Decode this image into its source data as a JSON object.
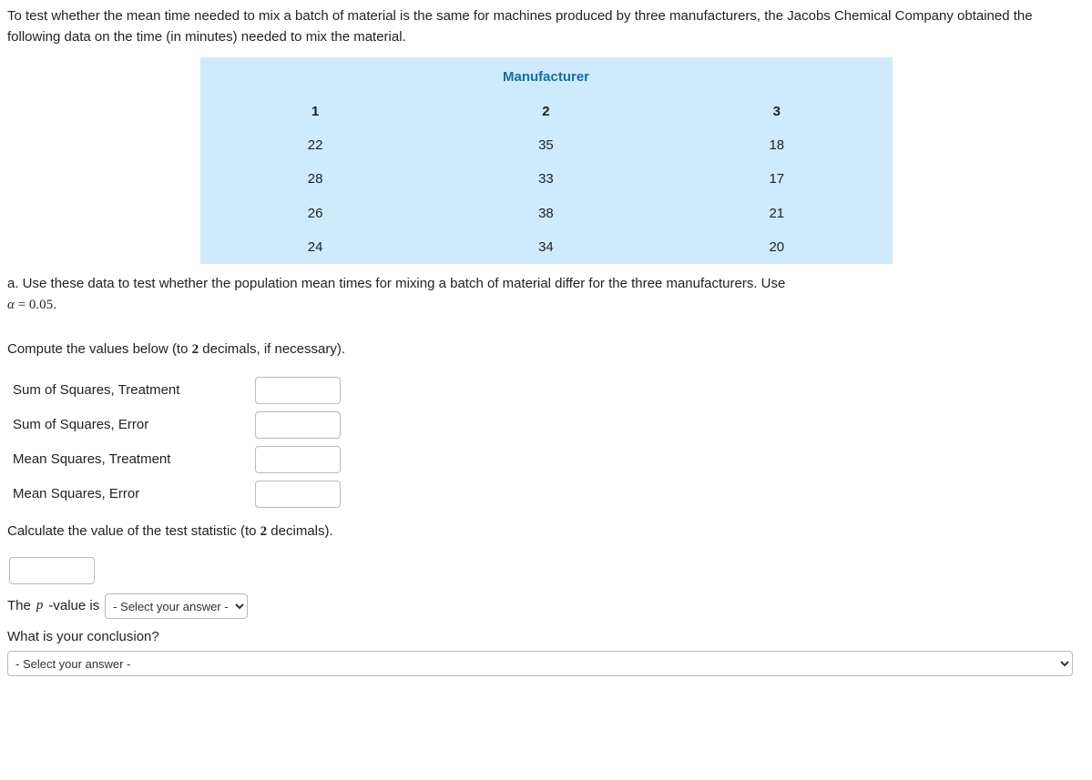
{
  "intro": "To test whether the mean time needed to mix a batch of material is the same for machines produced by three manufacturers, the Jacobs Chemical Company obtained the following data on the time (in minutes) needed to mix the material.",
  "table": {
    "title": "Manufacturer",
    "headers": [
      "1",
      "2",
      "3"
    ],
    "rows": [
      [
        "22",
        "35",
        "18"
      ],
      [
        "28",
        "33",
        "17"
      ],
      [
        "26",
        "38",
        "21"
      ],
      [
        "24",
        "34",
        "20"
      ]
    ]
  },
  "qa_prefix": "a.",
  "qa_text": " Use these data to test whether the population mean times for mixing a batch of material differ for the three manufacturers. Use ",
  "alpha_expr_lhs": "α",
  "alpha_expr_eq": " = ",
  "alpha_expr_rhs": "0.05",
  "period": ".",
  "compute_prefix": "Compute the values below (to ",
  "compute_two": "2",
  "compute_suffix": " decimals, if necessary).",
  "fields": {
    "sst": "Sum of Squares, Treatment",
    "sse": "Sum of Squares, Error",
    "mst": "Mean Squares, Treatment",
    "mse": "Mean Squares, Error"
  },
  "calc_prefix": "Calculate the value of the test statistic (to ",
  "calc_two": "2",
  "calc_suffix": " decimals).",
  "pval_prefix": "The ",
  "pval_p": "p",
  "pval_suffix": "-value is",
  "select_placeholder": "- Select your answer -",
  "conclusion_q": "What is your conclusion?",
  "select2_placeholder": "- Select your answer -"
}
